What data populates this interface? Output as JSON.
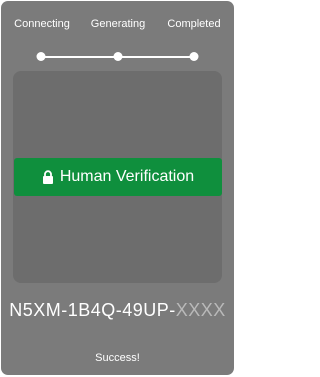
{
  "steps": [
    {
      "label": "Connecting"
    },
    {
      "label": "Generating"
    },
    {
      "label": "Completed"
    }
  ],
  "progress": {
    "current_step": 3,
    "total_steps": 3
  },
  "verify_button": {
    "label": "Human Verification",
    "icon": "lock-icon",
    "color": "#0f8f3d"
  },
  "code": {
    "visible": "N5XM-1B4Q-49UP-",
    "masked": "XXXX"
  },
  "status": {
    "text": "Success!"
  },
  "colors": {
    "panel": "#7b7b7b",
    "content_box": "#6d6d6d",
    "text": "#ffffff",
    "masked_text": "#b9b9b9"
  }
}
